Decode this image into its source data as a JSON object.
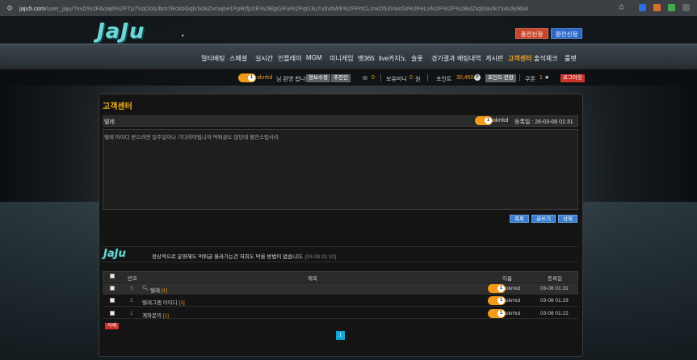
{
  "browser": {
    "url_domain": "jaju5.com",
    "url_path": "/user_jaju/?xvD%2FAoaj6%2FTp7VqDobJbm7RckbGqlvSokZvcwjne1FpRIfpXE%2BlgGiFa%2FqG3u7u3vbWk%2FPrtCLmxO53VwcGt%2FeLv%2F%2F%2BxlZiq6IaVik7x4u3y9bi4"
  },
  "header": {
    "logo": "JaJu",
    "deposit_label": "충전신청",
    "withdraw_label": "환전신청"
  },
  "nav": {
    "items": [
      "멀티베팅",
      "스페셜",
      "실시간",
      "인플레이",
      "MGM",
      "미니게임",
      "벳365",
      "live카지노",
      "슬롯",
      "경기결과",
      "배팅내역",
      "게시판",
      "고객센터",
      "출석체크",
      "룰렛"
    ],
    "active": "고객센터"
  },
  "userbar": {
    "level": "1",
    "username": "okrrkd",
    "greeting": "님 환영 합니다.",
    "edit_info_label": "정보수정",
    "recommender_label": "추천인",
    "messages": "0",
    "balance_label": "보유머니",
    "balance": "0",
    "balance_unit": "원",
    "points_label": "포인트",
    "points": "30,450",
    "points_icon": "P",
    "points_convert_label": "포인트 전환",
    "coupon_label": "쿠폰",
    "coupon_count": "1",
    "logout_label": "로그아웃"
  },
  "page": {
    "title": "고객센터"
  },
  "post": {
    "subject": "텔레",
    "author_level": "1",
    "author": "okrrkd",
    "date_label": "등록일 : 26-03-08 01:31",
    "body": "텔레 아이디 받으려면 일주일이나 기다려야됩니까 먹튀글도 많던데 불안스럽사리",
    "buttons": {
      "list": "목록",
      "write": "글쓰기",
      "delete": "삭제"
    }
  },
  "comment": {
    "logo": "JaJu",
    "text": "정상적으로 운영해도 먹튀글 올라가는건 저희도 막을 방법이 없습니다.",
    "date": "[03-08 01:32]"
  },
  "table": {
    "headers": {
      "num": "번호",
      "subject": "제목",
      "name": "이름",
      "date": "등록일"
    },
    "rows": [
      {
        "num": "3",
        "subject": "텔레",
        "count": "[1]",
        "level": "1",
        "name": "okrrkd",
        "date": "03-08 01:31"
      },
      {
        "num": "2",
        "subject": "텔레그램 아이디",
        "count": "[1]",
        "level": "1",
        "name": "okrrkd",
        "date": "03-08 01:29"
      },
      {
        "num": "1",
        "subject": "계좌문의",
        "count": "[1]",
        "level": "1",
        "name": "okrrkd",
        "date": "03-08 01:22"
      }
    ],
    "delete_label": "삭제",
    "current_page": "1"
  }
}
